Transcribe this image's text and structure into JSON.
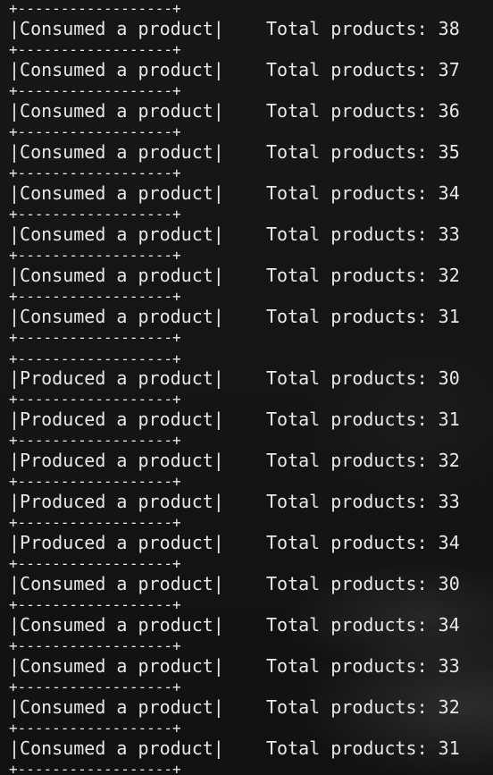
{
  "terminal": {
    "border_line": "+------------------+",
    "rows": [
      {
        "message": "|Consumed a product|",
        "total": "Total products: 38"
      },
      {
        "message": "|Consumed a product|",
        "total": "Total products: 37"
      },
      {
        "message": "|Consumed a product|",
        "total": "Total products: 36"
      },
      {
        "message": "|Consumed a product|",
        "total": "Total products: 35"
      },
      {
        "message": "|Consumed a product|",
        "total": "Total products: 34"
      },
      {
        "message": "|Consumed a product|",
        "total": "Total products: 33"
      },
      {
        "message": "|Consumed a product|",
        "total": "Total products: 32"
      },
      {
        "message": "|Consumed a product|",
        "total": "Total products: 31"
      },
      {
        "message": "|Produced a product|",
        "total": "Total products: 30"
      },
      {
        "message": "|Produced a product|",
        "total": "Total products: 31"
      },
      {
        "message": "|Produced a product|",
        "total": "Total products: 32"
      },
      {
        "message": "|Produced a product|",
        "total": "Total products: 33"
      },
      {
        "message": "|Produced a product|",
        "total": "Total products: 34"
      },
      {
        "message": "|Consumed a product|",
        "total": "Total products: 30"
      },
      {
        "message": "|Consumed a product|",
        "total": "Total products: 34"
      },
      {
        "message": "|Consumed a product|",
        "total": "Total products: 33"
      },
      {
        "message": "|Consumed a product|",
        "total": "Total products: 32"
      },
      {
        "message": "|Consumed a product|",
        "total": "Total products: 31"
      }
    ]
  }
}
